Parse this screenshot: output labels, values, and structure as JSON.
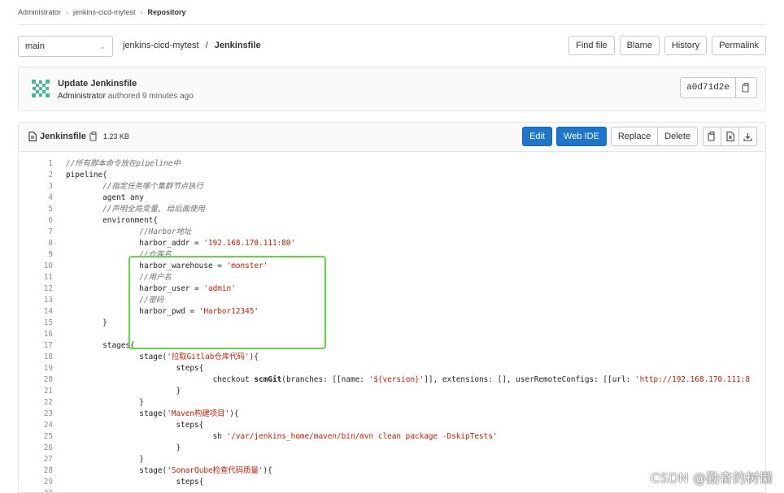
{
  "breadcrumb": [
    "Administrator",
    "jenkins-cicd-mytest",
    "Repository"
  ],
  "branch": "main",
  "path": {
    "project": "jenkins-cicd-mytest",
    "separator": "/",
    "file": "Jenkinsfile"
  },
  "file_actions": [
    "Find file",
    "Blame",
    "History",
    "Permalink"
  ],
  "commit": {
    "title": "Update Jenkinsfile",
    "author": "Administrator",
    "meta": "authored 9 minutes ago",
    "sha": "a0d71d2e"
  },
  "file_header": {
    "name": "Jenkinsfile",
    "size": "1.23 KB",
    "edit_label": "Edit",
    "webide_label": "Web IDE",
    "replace_label": "Replace",
    "delete_label": "Delete"
  },
  "code_lines": [
    {
      "n": "1",
      "parts": [
        {
          "t": "//所有脚本命令放在pipeline中",
          "c": "c"
        }
      ]
    },
    {
      "n": "2",
      "parts": [
        {
          "t": "pipeline{",
          "c": ""
        }
      ]
    },
    {
      "n": "3",
      "parts": [
        {
          "t": "        ",
          "c": ""
        },
        {
          "t": "//指定任务哪个集群节点执行",
          "c": "c"
        }
      ]
    },
    {
      "n": "4",
      "parts": [
        {
          "t": "        agent any",
          "c": ""
        }
      ]
    },
    {
      "n": "5",
      "parts": [
        {
          "t": "        ",
          "c": ""
        },
        {
          "t": "//声明全局变量, 给后面使用",
          "c": "c"
        }
      ]
    },
    {
      "n": "6",
      "parts": [
        {
          "t": "        environment{",
          "c": ""
        }
      ]
    },
    {
      "n": "7",
      "parts": [
        {
          "t": "                ",
          "c": ""
        },
        {
          "t": "//Harbor地址",
          "c": "c"
        }
      ]
    },
    {
      "n": "8",
      "parts": [
        {
          "t": "                harbor_addr = ",
          "c": ""
        },
        {
          "t": "'192.168.170.111:80'",
          "c": "s"
        }
      ]
    },
    {
      "n": "9",
      "parts": [
        {
          "t": "                ",
          "c": ""
        },
        {
          "t": "//仓库名",
          "c": "c"
        }
      ]
    },
    {
      "n": "10",
      "parts": [
        {
          "t": "                harbor_warehouse = ",
          "c": ""
        },
        {
          "t": "'monster'",
          "c": "s"
        }
      ]
    },
    {
      "n": "11",
      "parts": [
        {
          "t": "                ",
          "c": ""
        },
        {
          "t": "//用户名",
          "c": "c"
        }
      ]
    },
    {
      "n": "12",
      "parts": [
        {
          "t": "                harbor_user = ",
          "c": ""
        },
        {
          "t": "'admin'",
          "c": "s"
        }
      ]
    },
    {
      "n": "13",
      "parts": [
        {
          "t": "                ",
          "c": ""
        },
        {
          "t": "//密码",
          "c": "c"
        }
      ]
    },
    {
      "n": "14",
      "parts": [
        {
          "t": "                harbor_pwd = ",
          "c": ""
        },
        {
          "t": "'Harbor12345'",
          "c": "s"
        }
      ]
    },
    {
      "n": "15",
      "parts": [
        {
          "t": "        }",
          "c": ""
        }
      ]
    },
    {
      "n": "16",
      "parts": [
        {
          "t": "",
          "c": ""
        }
      ]
    },
    {
      "n": "17",
      "parts": [
        {
          "t": "        stages{",
          "c": ""
        }
      ]
    },
    {
      "n": "18",
      "parts": [
        {
          "t": "                stage(",
          "c": ""
        },
        {
          "t": "'拉取Gitlab仓库代码'",
          "c": "s"
        },
        {
          "t": "){",
          "c": ""
        }
      ]
    },
    {
      "n": "19",
      "parts": [
        {
          "t": "                        steps{",
          "c": ""
        }
      ]
    },
    {
      "n": "20",
      "parts": [
        {
          "t": "                                checkout ",
          "c": ""
        },
        {
          "t": "scmGit",
          "c": "k"
        },
        {
          "t": "(branches: [[name: ",
          "c": ""
        },
        {
          "t": "'${version}'",
          "c": "s"
        },
        {
          "t": "]], extensions: [], userRemoteConfigs: [[url: ",
          "c": ""
        },
        {
          "t": "'http://192.168.170.111:8",
          "c": "s"
        }
      ]
    },
    {
      "n": "21",
      "parts": [
        {
          "t": "                        }",
          "c": ""
        }
      ]
    },
    {
      "n": "22",
      "parts": [
        {
          "t": "                }",
          "c": ""
        }
      ]
    },
    {
      "n": "23",
      "parts": [
        {
          "t": "                stage(",
          "c": ""
        },
        {
          "t": "'Maven构建项目'",
          "c": "s"
        },
        {
          "t": "){",
          "c": ""
        }
      ]
    },
    {
      "n": "24",
      "parts": [
        {
          "t": "                        steps{",
          "c": ""
        }
      ]
    },
    {
      "n": "25",
      "parts": [
        {
          "t": "                                sh ",
          "c": ""
        },
        {
          "t": "'/var/jenkins_home/maven/bin/mvn clean package -DskipTests'",
          "c": "s"
        }
      ]
    },
    {
      "n": "26",
      "parts": [
        {
          "t": "                        }",
          "c": ""
        }
      ]
    },
    {
      "n": "27",
      "parts": [
        {
          "t": "                }",
          "c": ""
        }
      ]
    },
    {
      "n": "28",
      "parts": [
        {
          "t": "                stage(",
          "c": ""
        },
        {
          "t": "'SonarQube检查代码质量'",
          "c": "s"
        },
        {
          "t": "){",
          "c": ""
        }
      ]
    },
    {
      "n": "29",
      "parts": [
        {
          "t": "                        steps{",
          "c": ""
        }
      ]
    },
    {
      "n": "30",
      "parts": [
        {
          "t": "",
          "c": ""
        }
      ]
    }
  ],
  "watermark": "CSDN @勤奋的树懒"
}
